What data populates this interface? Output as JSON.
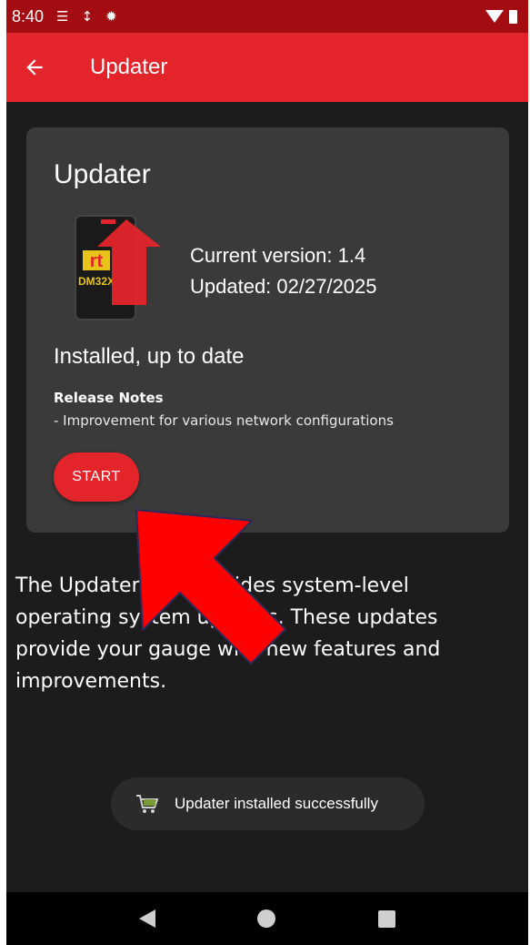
{
  "status_bar": {
    "time": "8:40",
    "icons": [
      "sim-icon",
      "usb-debug-icon",
      "bug-icon"
    ],
    "right_icons": [
      "wifi-icon",
      "battery-icon"
    ]
  },
  "app_bar": {
    "title": "Updater",
    "back_icon": "arrow-back-icon"
  },
  "card": {
    "title": "Updater",
    "product_logo_text": "rt",
    "product_model": "DM32X",
    "current_version_label": "Current version: 1.4",
    "updated_label": "Updated: 02/27/2025",
    "install_status": "Installed, up to date",
    "release_notes_heading": "Release Notes",
    "release_notes_body": "- Improvement for various network configurations",
    "start_button_label": "START"
  },
  "description": {
    "line1": "The Updater app provides system-level",
    "line2": "operating system updates. These updates",
    "line3": "provide your gauge with new features and",
    "line4": "improvements."
  },
  "toast": {
    "icon": "shopping-cart-icon",
    "message": "Updater installed successfully"
  },
  "nav_bar": {
    "icons": [
      "nav-back-icon",
      "nav-home-icon",
      "nav-recents-icon"
    ]
  },
  "colors": {
    "status_bar": "#a30c10",
    "app_bar": "#e3242b",
    "background": "#1c1c1c",
    "card": "#3a3a3a",
    "accent": "#e3242b",
    "annotation_arrow": "#ff0000"
  }
}
